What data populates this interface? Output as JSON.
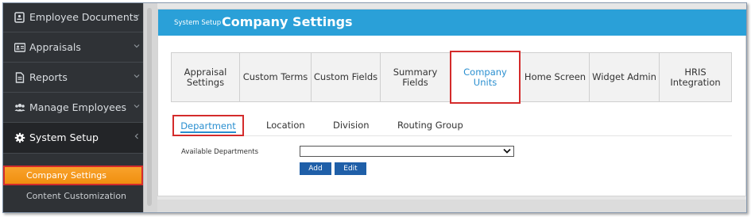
{
  "sidebar": {
    "items": [
      {
        "label": "Employee Documents",
        "icon": "id-card-icon"
      },
      {
        "label": "Appraisals",
        "icon": "contact-card-icon"
      },
      {
        "label": "Reports",
        "icon": "document-icon"
      },
      {
        "label": "Manage Employees",
        "icon": "users-icon"
      },
      {
        "label": "System Setup",
        "icon": "gear-icon"
      }
    ],
    "sub_items": [
      {
        "label": "Company Settings"
      },
      {
        "label": "Content Customization"
      }
    ]
  },
  "header": {
    "breadcrumb": "System Setup",
    "title": "Company Settings"
  },
  "tabs": [
    {
      "label": "Appraisal\nSettings"
    },
    {
      "label": "Custom Terms"
    },
    {
      "label": "Custom Fields"
    },
    {
      "label": "Summary Fields"
    },
    {
      "label": "Company Units"
    },
    {
      "label": "Home Screen"
    },
    {
      "label": "Widget Admin"
    },
    {
      "label": "HRIS Integration"
    }
  ],
  "subtabs": [
    {
      "label": "Department"
    },
    {
      "label": "Location"
    },
    {
      "label": "Division"
    },
    {
      "label": "Routing Group"
    }
  ],
  "form": {
    "available_label": "Available Departments",
    "select_value": "",
    "add_label": "Add",
    "edit_label": "Edit"
  },
  "colors": {
    "header_blue": "#2aa0d8",
    "sidebar_bg": "#2f3236",
    "highlight_orange": "#f39a1e",
    "annotation_red": "#d42b2b",
    "button_blue": "#1f5fa8"
  }
}
